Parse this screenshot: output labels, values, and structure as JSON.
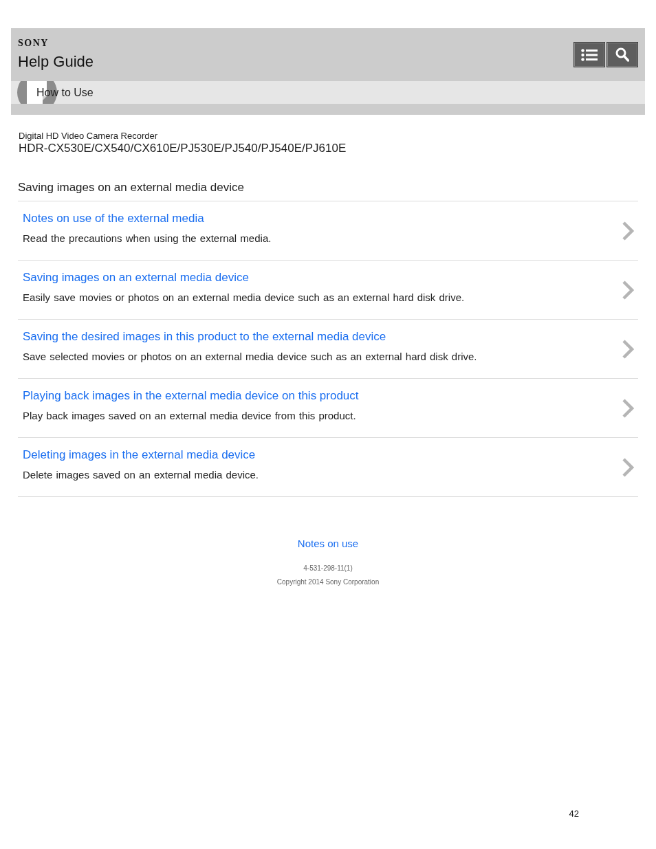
{
  "header": {
    "logo": "SONY",
    "title": "Help Guide",
    "buttons": [
      {
        "kind": "list"
      },
      {
        "kind": "search"
      }
    ]
  },
  "breadcrumb": {
    "label": "How to Use"
  },
  "product": {
    "category": "Digital HD Video Camera Recorder",
    "models": "HDR-CX530E/CX540/CX610E/PJ530E/PJ540/PJ540E/PJ610E"
  },
  "section_title": "Saving images on an external media device",
  "topics": [
    {
      "title": "Notes on use of the external media",
      "description": "Read the precautions when using the external media."
    },
    {
      "title": "Saving images on an external media device",
      "description": "Easily save movies or photos on an external media device such as an external hard disk drive."
    },
    {
      "title": "Saving the desired images in this product to the external media device",
      "description": "Save selected movies or photos on an external media device such as an external hard disk drive."
    },
    {
      "title": "Playing back images in the external media device on this product",
      "description": "Play back images saved on an external media device from this product."
    },
    {
      "title": "Deleting images in the external media device",
      "description": "Delete images saved on an external media device."
    }
  ],
  "footer": {
    "link": "Notes on use",
    "code": "4-531-298-11(1)",
    "copyright": "Copyright 2014 Sony Corporation"
  },
  "page_number": "42"
}
